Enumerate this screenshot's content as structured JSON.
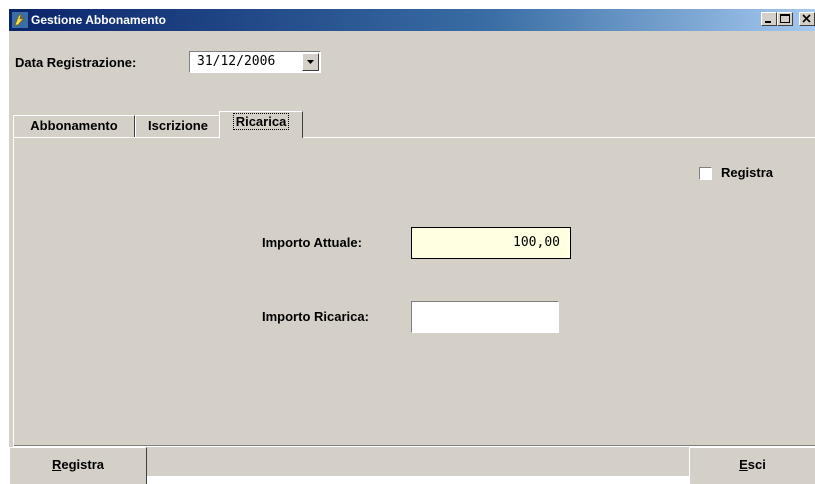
{
  "window": {
    "title": "Gestione Abbonamento"
  },
  "header": {
    "date_label": "Data Registrazione:",
    "date_value": "31/12/2006"
  },
  "tabs": [
    {
      "label": "Abbonamento"
    },
    {
      "label": "Iscrizione"
    },
    {
      "label": "Ricarica"
    }
  ],
  "ricarica": {
    "checkbox_label": "Registra",
    "importo_attuale_label": "Importo Attuale:",
    "importo_attuale_value": "100,00",
    "importo_ricarica_label": "Importo Ricarica:",
    "importo_ricarica_value": ""
  },
  "buttons": {
    "registra_mnemonic": "R",
    "registra_rest": "egistra",
    "esci_mnemonic": "E",
    "esci_rest": "sci"
  },
  "colors": {
    "title_bar": "#0a246a",
    "readonly_field": "#ffffe1",
    "face": "#d4d0c8"
  }
}
